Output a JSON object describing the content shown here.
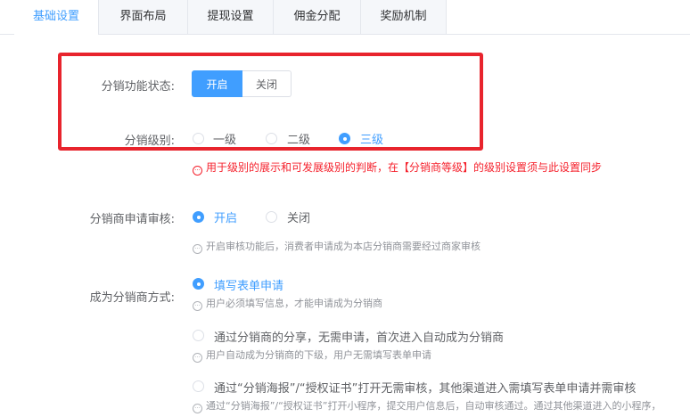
{
  "tabs": [
    "基础设置",
    "界面布局",
    "提现设置",
    "佣金分配",
    "奖励机制"
  ],
  "accent_color": "#409eff",
  "highlight_color": "#e8242d",
  "distribution_status": {
    "label": "分销功能状态:",
    "on": "开启",
    "off": "关闭",
    "selected": "开启"
  },
  "distribution_level": {
    "label": "分销级别:",
    "options": [
      "一级",
      "二级",
      "三级"
    ],
    "selected": "三级",
    "hint": "用于级别的展示和可发展级别的判断，在【分销商等级】的级别设置须与此设置同步"
  },
  "review": {
    "label": "分销商申请审核:",
    "options": [
      "开启",
      "关闭"
    ],
    "selected": "开启",
    "hint": "开启审核功能后，消费者申请成为本店分销商需要经过商家审核"
  },
  "become": {
    "label": "成为分销商方式:",
    "options": [
      {
        "text": "填写表单申请",
        "hint": "用户必须填写信息，才能申请成为分销商"
      },
      {
        "text": "通过分销商的分享，无需申请，首次进入自动成为分销商",
        "hint": "用户自动成为分销商的下级，用户无需填写表单申请"
      },
      {
        "text": "通过“分销海报”/“授权证书”打开无需审核，其他渠道进入需填写表单申请并需审核",
        "hint": "通过“分销海报”/“授权证书”打开小程序，提交用户信息后，自动审核通过。通过其他渠道进入的小程序，"
      }
    ],
    "selected": "填写表单申请"
  }
}
